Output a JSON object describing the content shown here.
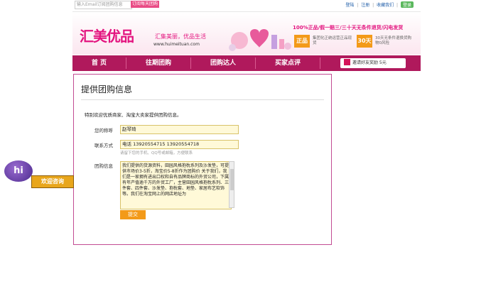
{
  "topbar": {
    "email_placeholder": "输入Email订阅团购信息",
    "subscribe_label": "订阅每天团购",
    "links": [
      "登陆",
      "注册",
      "收藏我们"
    ],
    "qq_label": "登录"
  },
  "header": {
    "logo_text": "汇美优品",
    "slogan": "汇集美丽，优品生活",
    "domain": "www.huimeituan.com",
    "promo_title": "100%正品/假一赔三/三十天无条件退货/闪电发货",
    "badge1": "正品",
    "badge1_desc": "集团化正统运营正品现货",
    "badge2": "30天",
    "badge2_desc": "30天无条件退换货购物0风险"
  },
  "nav": {
    "items": [
      "首  页",
      "往期团购",
      "团购达人",
      "买家点评"
    ],
    "invite_label": "邀请好友奖励 5元"
  },
  "panel": {
    "title": "提供团购信息",
    "intro": "特别欢迎优质商家、淘宝大卖家提供团购信息。",
    "name_label": "您的称呼",
    "name_value": "赵琴琦",
    "contact_label": "联系方式",
    "contact_value": "电话 13920554715      13920554718",
    "contact_hint": "请留下您的手机、QQ号或邮箱，方便联系",
    "info_label": "团购信息",
    "info_value": "我们提供的货源资料，田园风格抱枕系列及沙发垫，可提供市场价3-5折，淘宝价5-8折作为团购价\n关于我们，我们是一家拥有进出口权和自有品牌商标的外贸公司，下属有年产值逾千万的外贸工厂，主营田园风格抱枕系列、三件套、四件套、沙发垫、抱枕套、地垫、家居布艺软饰等。我们在淘宝网上的网店地址为",
    "submit_label": "提交"
  },
  "float_chat": {
    "hi_text": "hi",
    "label": "欢迎咨询"
  }
}
